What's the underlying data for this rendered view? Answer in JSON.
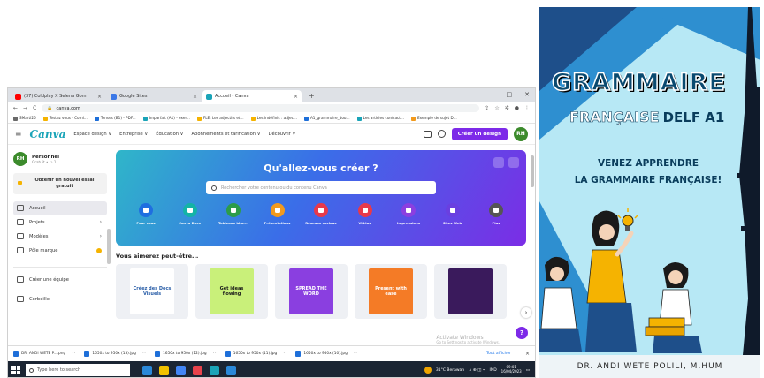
{
  "browser": {
    "tabs": [
      {
        "label": "(37) Coldplay X Selena Gom",
        "fav_color": "#ff0000",
        "active": false
      },
      {
        "label": "Google Sites",
        "fav_color": "#3b78e7",
        "active": false
      },
      {
        "label": "Accueil - Canva",
        "fav_color": "#1aa4b8",
        "active": true
      }
    ],
    "new_tab": "+",
    "url": "canva.com",
    "bookmarks": [
      "SMarti26",
      "Testez vous - Comi...",
      "Tenses (B1) - PDF...",
      "Imparfait (A1) - exer...",
      "FLE: Les adjectifs et...",
      "Les indéfinis : adjec...",
      "A1_grammaire_dou...",
      "Les articles contract...",
      "Exemple de sujet D..."
    ]
  },
  "canva": {
    "logo": "Canva",
    "nav": [
      "Espace design ∨",
      "Entreprise ∨",
      "Éducation ∨",
      "Abonnements et tarification ∨",
      "Découvrir ∨"
    ],
    "create_button": "Créer un design",
    "avatar": "RH",
    "account": {
      "initials": "RH",
      "name": "Personnel",
      "sub": "Gratuit • ⚇ 1"
    },
    "trial": "Obtenir un nouvel essai gratuit",
    "sidebar": [
      {
        "label": "Accueil",
        "icon": "home-icon",
        "active": true,
        "chevron": false
      },
      {
        "label": "Projets",
        "icon": "folder-icon",
        "active": false,
        "chevron": true
      },
      {
        "label": "Modèles",
        "icon": "templates-icon",
        "active": false,
        "chevron": true
      },
      {
        "label": "Pôle marque",
        "icon": "brand-icon",
        "active": false,
        "chevron": false
      }
    ],
    "sidebar_bottom": [
      {
        "label": "Créer une équipe",
        "icon": "team-icon"
      },
      {
        "label": "Corbeille",
        "icon": "trash-icon"
      }
    ],
    "hero": {
      "title": "Qu'allez-vous créer ?",
      "search_placeholder": "Rechercher votre contenu ou du contenu Canva",
      "categories": [
        {
          "label": "Pour vous",
          "color": "#1f6fe0"
        },
        {
          "label": "Canva Docs",
          "color": "#14b3a6"
        },
        {
          "label": "Tableaux blan...",
          "color": "#2c9c4a"
        },
        {
          "label": "Présentations",
          "color": "#f29a1d"
        },
        {
          "label": "Réseaux sociaux",
          "color": "#e8394a"
        },
        {
          "label": "Vidéos",
          "color": "#e8394a"
        },
        {
          "label": "Impressions",
          "color": "#8b3fe0"
        },
        {
          "label": "Sites Web",
          "color": "#6a3fe0"
        },
        {
          "label": "Plus",
          "color": "#555555"
        }
      ]
    },
    "suggest_title": "Vous aimerez peut-être...",
    "cards": [
      {
        "text": "Créez des Docs Visuels",
        "bg": "#ffffff",
        "fg": "#2b5fa8"
      },
      {
        "text": "Get ideas flowing",
        "bg": "#c9f07a",
        "fg": "#1a1a1a"
      },
      {
        "text": "SPREAD THE WORD",
        "bg": "#8a3fe0",
        "fg": "#ffffff"
      },
      {
        "text": "Present with ease",
        "bg": "#f47b26",
        "fg": "#ffffff"
      },
      {
        "text": "",
        "bg": "#3a1a5c",
        "fg": "#ffffff"
      }
    ],
    "next_button": "›",
    "help_button": "?"
  },
  "watermark": {
    "line1": "Activate Windows",
    "line2": "Go to Settings to activate Windows."
  },
  "downloads": {
    "items": [
      "DR. ANDI WETE P....png",
      "1650x to 950x (13).jpg",
      "1650x to 950x (12).jpg",
      "1650x to 950x (11).jpg",
      "1650x to 950x (10).jpg"
    ],
    "show_all": "Tout afficher",
    "close": "×"
  },
  "taskbar": {
    "search": "Type here to search",
    "apps": [
      "#2b88d8",
      "#f2c200",
      "#4285f4",
      "#e8434c",
      "#1aa4b8",
      "#2b88d8"
    ],
    "weather": "31°C  Berawan",
    "lang": "IND",
    "time": "09:01",
    "date": "16/04/2023"
  },
  "poster": {
    "title": "GRAMMAIRE",
    "subtitle": "FRANÇAISE",
    "subtitle_level": "DELF A1",
    "tagline1": "VENEZ APPRENDRE",
    "tagline2": "LA GRAMMAIRE FRANÇAISE!",
    "author": "DR. ANDI WETE POLILI, M.HUM",
    "colors": {
      "bg": "#b7e8f5",
      "triangle_dark": "#1e4f8a",
      "triangle_light": "#2e8fd0",
      "tower": "#0f1a2a",
      "accent": "#f5b301"
    }
  }
}
